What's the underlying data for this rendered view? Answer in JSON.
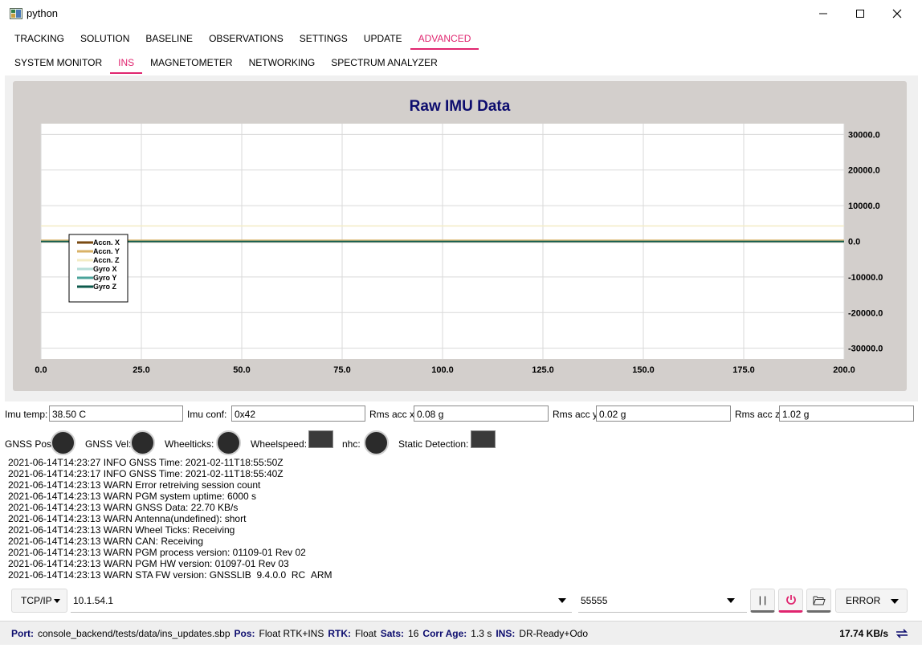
{
  "window": {
    "title": "python"
  },
  "tabs_main": [
    "TRACKING",
    "SOLUTION",
    "BASELINE",
    "OBSERVATIONS",
    "SETTINGS",
    "UPDATE",
    "ADVANCED"
  ],
  "tabs_main_active": "ADVANCED",
  "tabs_sub": [
    "SYSTEM MONITOR",
    "INS",
    "MAGNETOMETER",
    "NETWORKING",
    "SPECTRUM ANALYZER"
  ],
  "tabs_sub_active": "INS",
  "chart_data": {
    "type": "line",
    "title": "Raw IMU Data",
    "xlim": [
      0,
      200
    ],
    "ylim": [
      -33000,
      33000
    ],
    "x_ticks": [
      "0.0",
      "25.0",
      "50.0",
      "75.0",
      "100.0",
      "125.0",
      "150.0",
      "175.0",
      "200.0"
    ],
    "y_ticks": [
      "30000.0",
      "20000.0",
      "10000.0",
      "0.0",
      "-10000.0",
      "-20000.0",
      "-30000.0"
    ],
    "y_tick_values": [
      30000,
      20000,
      10000,
      0,
      -10000,
      -20000,
      -30000
    ],
    "grid": true,
    "legend_position": "left",
    "series": [
      {
        "name": "Accn. X",
        "color": "#7a4a12",
        "values": [
          -200,
          -200
        ]
      },
      {
        "name": "Accn. Y",
        "color": "#d9b266",
        "values": [
          300,
          300
        ]
      },
      {
        "name": "Accn. Z",
        "color": "#f3ecc4",
        "values": [
          4300,
          4300
        ]
      },
      {
        "name": "Gyro X",
        "color": "#b6ded8",
        "values": [
          0,
          0
        ]
      },
      {
        "name": "Gyro Y",
        "color": "#4aa39a",
        "values": [
          -100,
          -100
        ]
      },
      {
        "name": "Gyro Z",
        "color": "#0e5a4c",
        "values": [
          0,
          0
        ]
      }
    ],
    "x": [
      0,
      200
    ]
  },
  "info": {
    "imu_temp_label": "Imu temp:",
    "imu_temp": "38.50 C",
    "imu_conf_label": "Imu conf:",
    "imu_conf": "0x42",
    "rms_x_label": "Rms acc x:",
    "rms_x": "0.08 g",
    "rms_y_label": "Rms acc y:",
    "rms_y": "0.02 g",
    "rms_z_label": "Rms acc z:",
    "rms_z": "1.02 g"
  },
  "indicators": {
    "gnss_pos": "GNSS Pos:",
    "gnss_vel": "GNSS Vel:",
    "wheelticks": "Wheelticks:",
    "wheelspeed": "Wheelspeed:",
    "nhc": "nhc:",
    "static_detection": "Static Detection:"
  },
  "log": [
    "2021-06-14T14:23:27 INFO GNSS Time: 2021-02-11T18:55:50Z",
    "2021-06-14T14:23:17 INFO GNSS Time: 2021-02-11T18:55:40Z",
    "2021-06-14T14:23:13 WARN Error retreiving session count",
    "2021-06-14T14:23:13 WARN PGM system uptime: 6000 s",
    "2021-06-14T14:23:13 WARN GNSS Data: 22.70 KB/s",
    "2021-06-14T14:23:13 WARN Antenna(undefined): short",
    "2021-06-14T14:23:13 WARN Wheel Ticks: Receiving",
    "2021-06-14T14:23:13 WARN CAN: Receiving",
    "2021-06-14T14:23:13 WARN PGM process version: 01109-01 Rev 02",
    "2021-06-14T14:23:13 WARN PGM HW version: 01097-01 Rev 03",
    "2021-06-14T14:23:13 WARN STA FW version: GNSSLIB_9.4.0.0_RC_ARM"
  ],
  "connection": {
    "protocol": "TCP/IP",
    "host": "10.1.54.1",
    "port": "55555",
    "pause_label": "| |",
    "log_level": "ERROR"
  },
  "status": {
    "port_key": "Port:",
    "port_val": "console_backend/tests/data/ins_updates.sbp",
    "pos_key": "Pos:",
    "pos_val": "Float RTK+INS",
    "rtk_key": "RTK:",
    "rtk_val": "Float",
    "sats_key": "Sats:",
    "sats_val": "16",
    "corr_key": "Corr Age:",
    "corr_val": "1.3 s",
    "ins_key": "INS:",
    "ins_val": "DR-Ready+Odo",
    "rate": "17.74 KB/s"
  },
  "colors": {
    "accent": "#e0256f",
    "title": "#0c0c6e",
    "power": "#e0256f"
  }
}
